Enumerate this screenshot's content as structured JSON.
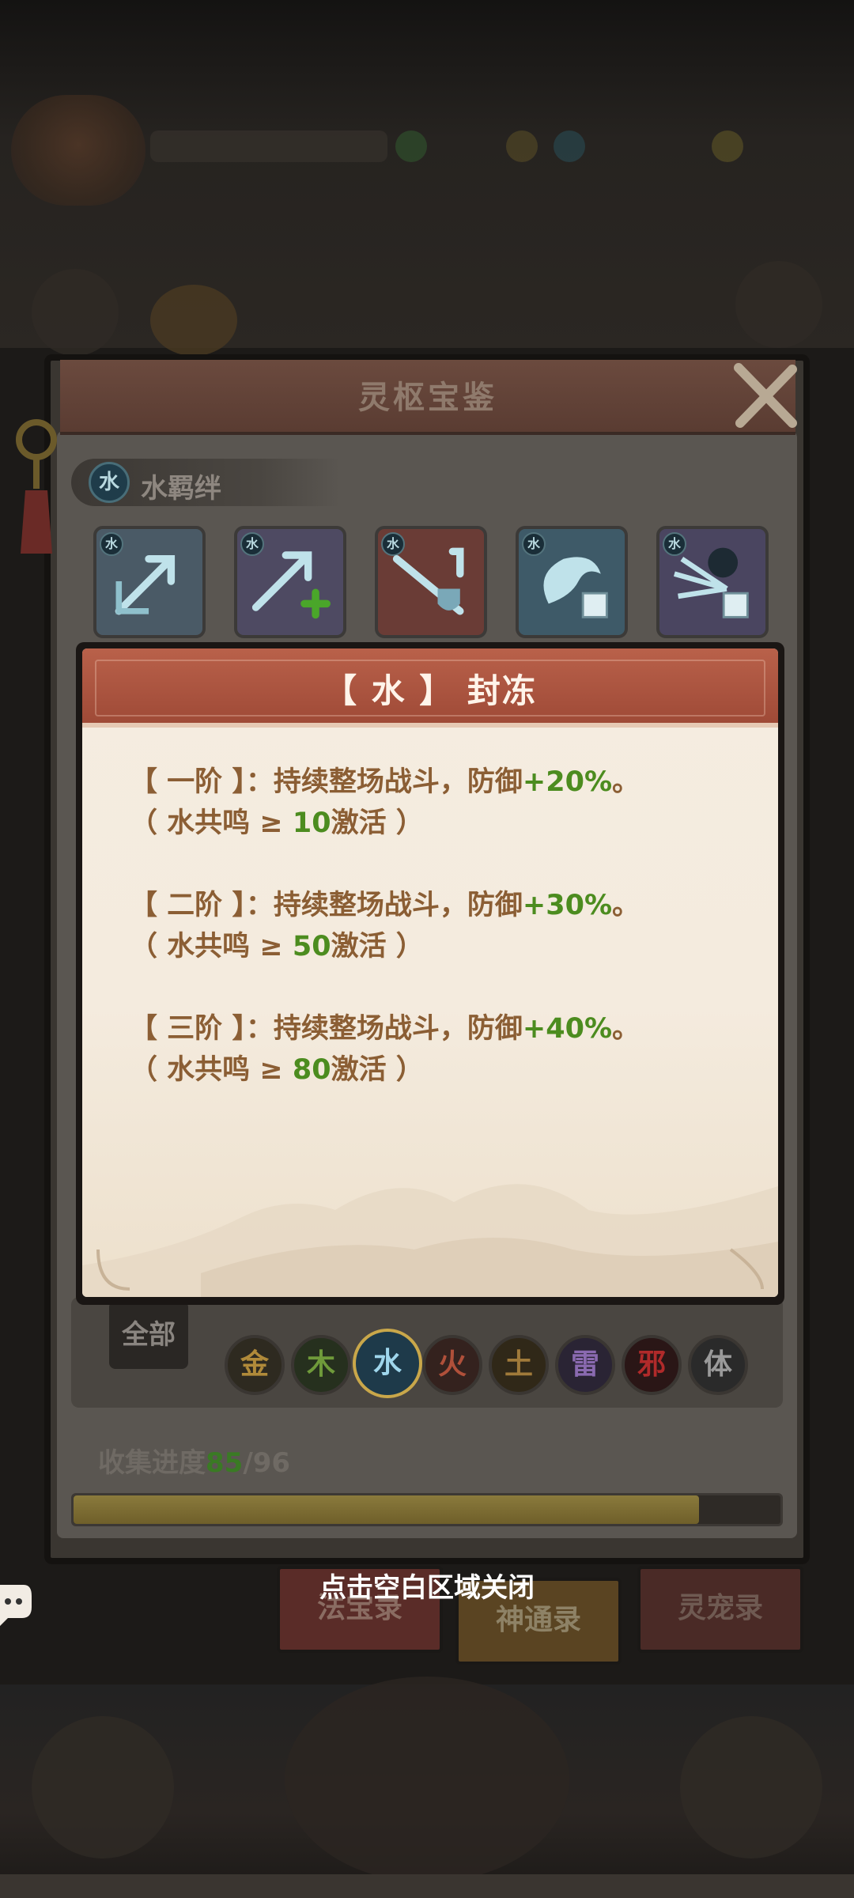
{
  "panel": {
    "title": "灵枢宝鉴",
    "bond_element": "水",
    "bond_label": "水羁绊",
    "skills": [
      {
        "element": "水",
        "icon": "ice-arrow-icon",
        "bg": "#4a5a66"
      },
      {
        "element": "水",
        "icon": "ice-arrow-plus-icon",
        "bg": "#4e4a62"
      },
      {
        "element": "水",
        "icon": "ice-arrow-shield-icon",
        "bg": "#6a3c36"
      },
      {
        "element": "水",
        "icon": "wave-icon",
        "bg": "#3e5a68"
      },
      {
        "element": "水",
        "icon": "frost-skull-icon",
        "bg": "#4a4560"
      }
    ]
  },
  "popup": {
    "title": "【 水 】 封冻",
    "tiers": [
      {
        "name": "【 一阶 】",
        "colon": "：",
        "effect": "持续整场战斗，防御",
        "bonus": "+20%",
        "end": "。",
        "cond_prefix": "（ 水共鸣 ≥ ",
        "cond_value": "10",
        "cond_suffix": "激活 ）"
      },
      {
        "name": "【 二阶 】",
        "colon": "：",
        "effect": "持续整场战斗，防御",
        "bonus": "+30%",
        "end": "。",
        "cond_prefix": "（ 水共鸣 ≥ ",
        "cond_value": "50",
        "cond_suffix": "激活 ）"
      },
      {
        "name": "【 三阶 】",
        "colon": "：",
        "effect": "持续整场战斗，防御",
        "bonus": "+40%",
        "end": "。",
        "cond_prefix": "（ 水共鸣 ≥ ",
        "cond_value": "80",
        "cond_suffix": "激活 ）"
      }
    ]
  },
  "filter": {
    "all_label": "全部",
    "elements": [
      {
        "label": "金",
        "color": "#b08a3a",
        "selected": false
      },
      {
        "label": "木",
        "color": "#6f9a3a",
        "selected": false
      },
      {
        "label": "水",
        "color": "#5aa6c8",
        "selected": true
      },
      {
        "label": "火",
        "color": "#b0503a",
        "selected": false
      },
      {
        "label": "土",
        "color": "#a07a3a",
        "selected": false
      },
      {
        "label": "雷",
        "color": "#8a6ab0",
        "selected": false
      },
      {
        "label": "邪",
        "color": "#b02a2a",
        "selected": false
      },
      {
        "label": "体",
        "color": "#9a9a9a",
        "selected": false
      }
    ]
  },
  "progress": {
    "label": "收集进度",
    "current": "85",
    "separator": "/",
    "total": "96",
    "fraction": 0.885
  },
  "tabs": [
    {
      "label": "法宝录",
      "active": false
    },
    {
      "label": "神通录",
      "active": true
    },
    {
      "label": "灵宠录",
      "active": false
    }
  ],
  "close_hint": "点击空白区域关闭",
  "colors": {
    "popup_header": "#b9614a",
    "tier_text": "#8b5e34",
    "highlight_green": "#4c8c1f"
  }
}
